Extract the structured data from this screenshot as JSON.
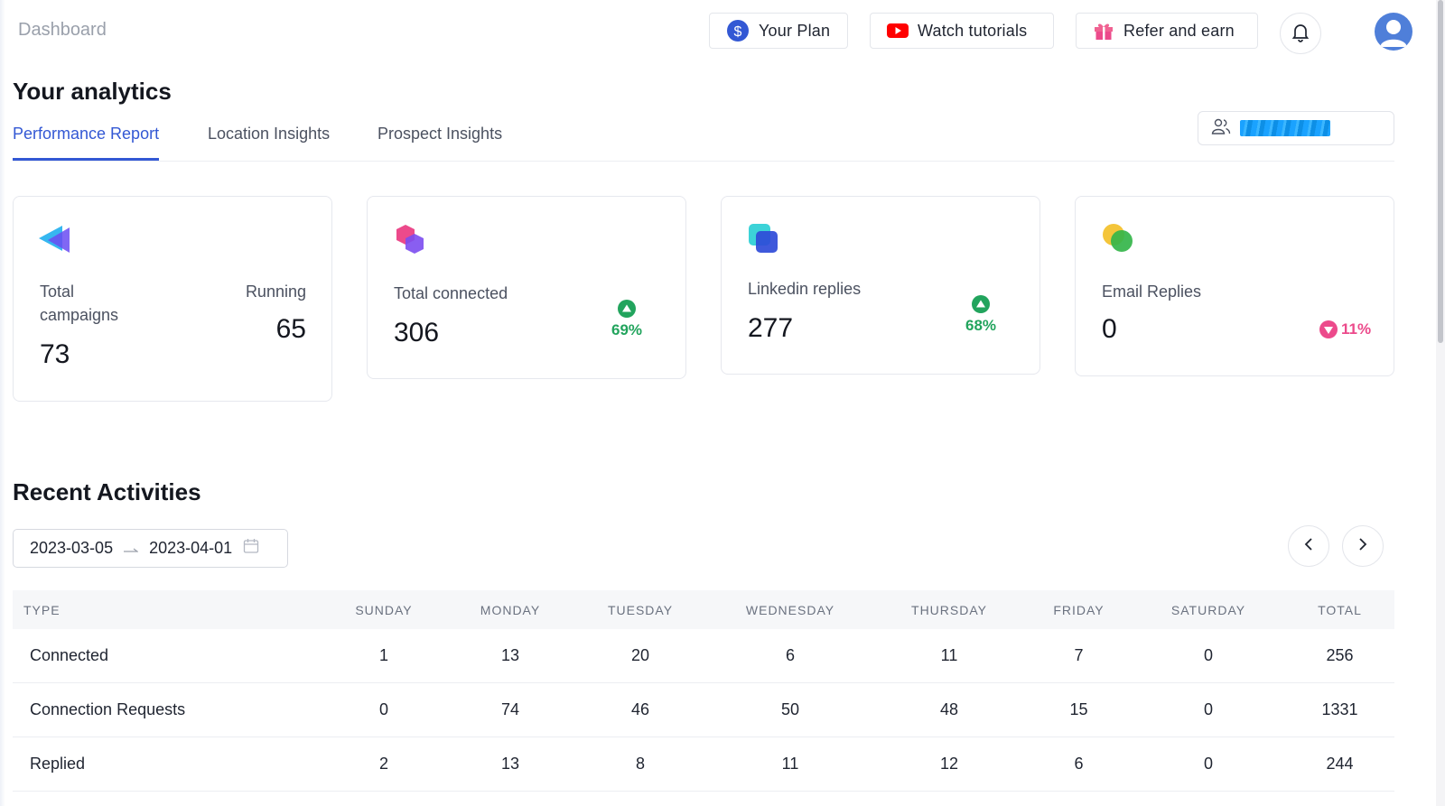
{
  "header": {
    "breadcrumb": "Dashboard",
    "your_plan": "Your Plan",
    "watch_tutorials": "Watch tutorials",
    "refer_and_earn": "Refer and earn"
  },
  "page_title": "Your analytics",
  "tabs": [
    {
      "label": "Performance Report",
      "active": true
    },
    {
      "label": "Location Insights",
      "active": false
    },
    {
      "label": "Prospect Insights",
      "active": false
    }
  ],
  "stats": {
    "campaigns": {
      "label": "Total campaigns",
      "value": "73",
      "running_label": "Running",
      "running_value": "65"
    },
    "connected": {
      "label": "Total connected",
      "value": "306",
      "trend": "69%"
    },
    "linkedin": {
      "label": "Linkedin replies",
      "value": "277",
      "trend": "68%"
    },
    "email": {
      "label": "Email Replies",
      "value": "0",
      "trend": "11%"
    }
  },
  "recent": {
    "title": "Recent Activities",
    "start_date": "2023-03-05",
    "end_date": "2023-04-01",
    "columns": [
      "TYPE",
      "SUNDAY",
      "MONDAY",
      "TUESDAY",
      "WEDNESDAY",
      "THURSDAY",
      "FRIDAY",
      "SATURDAY",
      "TOTAL"
    ],
    "rows": [
      [
        "Connected",
        "1",
        "13",
        "20",
        "6",
        "11",
        "7",
        "0",
        "256"
      ],
      [
        "Connection Requests",
        "0",
        "74",
        "46",
        "50",
        "48",
        "15",
        "0",
        "1331"
      ],
      [
        "Replied",
        "2",
        "13",
        "8",
        "11",
        "12",
        "6",
        "0",
        "244"
      ]
    ]
  },
  "colors": {
    "accent": "#3358d4",
    "trend_up": "#22a45d",
    "trend_down": "#ec4a8b",
    "avatar": "#4f7fd9"
  }
}
